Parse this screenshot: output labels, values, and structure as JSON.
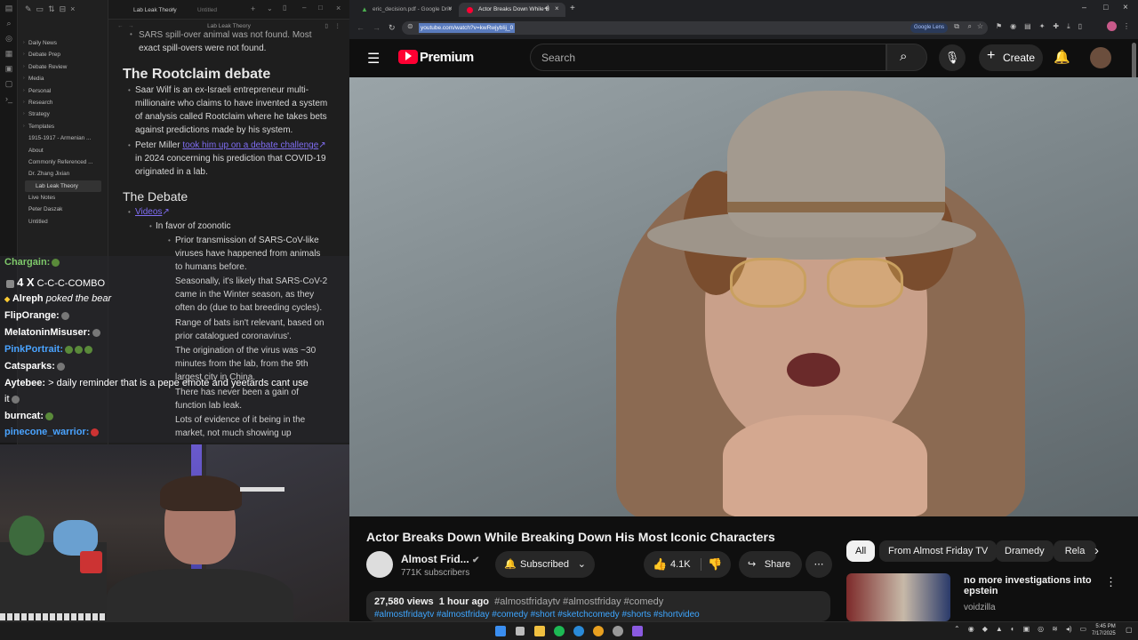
{
  "obsidian": {
    "tabs": [
      {
        "label": "Lab Leak Theory"
      },
      {
        "label": "Untitled"
      }
    ],
    "header": "Lab Leak Theory",
    "tree": [
      "Daily News",
      "Debate Prep",
      "Debate Review",
      "Media",
      "Personal",
      "Research",
      "Strategy",
      "Templates",
      "1915-1917 - Armenian ...",
      "About",
      "Commonly Referenced ...",
      "Dr. Zhang Jixian",
      "Lab Leak Theory",
      "Live Notes",
      "Peter Daszak",
      "Untitled"
    ],
    "content": {
      "top_line1": "SARS spill-over animal was not found. Most",
      "top_line2": "exact spill-overs were not found.",
      "h_rootclaim": "The Rootclaim debate",
      "p1": [
        "Saar Wilf is an ex-Israeli entrepreneur multi-",
        "millionaire who claims to have invented a system",
        "of analysis called Rootclaim where he takes bets",
        "against predictions made by his system."
      ],
      "p2_a": "Peter Miller",
      "p2_link": "took him up on a debate challenge",
      "p2_rest": [
        "in 2024 concerning his prediction that COVID-19",
        "originated in a lab."
      ],
      "h_debate": "The Debate",
      "videos_link": "Videos",
      "zoonotic": "In favor of zoonotic",
      "points": [
        [
          "Prior transmission of SARS-CoV-like",
          "viruses have happened from animals",
          "to humans before."
        ],
        [
          "Seasonally, it's likely that SARS-CoV-2",
          "came in the Winter season, as they",
          "often do (due to bat breeding cycles)."
        ],
        [
          "Range of bats isn't relevant, based on",
          "prior catalogued coronavirus'."
        ],
        [
          "The origination of the virus was ~30",
          "minutes from the lab, from the 9th",
          "largest city in China."
        ],
        [
          "There has never been a gain of",
          "function lab leak."
        ],
        [
          "Lots of evidence of it being in the",
          "market, not much showing up"
        ]
      ]
    }
  },
  "chat": [
    {
      "user": "Chargain:",
      "msg": "",
      "color": "#7ec86a"
    },
    {
      "user": "4 X",
      "msg": "C-C-C-COMBO",
      "color": "#ffffff"
    },
    {
      "user": "Alreph",
      "msg": "poked the bear",
      "color": "#ffffff"
    },
    {
      "user": "FlipOrange:",
      "msg": "",
      "color": "#ffffff"
    },
    {
      "user": "MelatoninMisuser:",
      "msg": "",
      "color": "#ffffff"
    },
    {
      "user": "PinkPortrait:",
      "msg": "",
      "color": "#4aa3ff"
    },
    {
      "user": "Catsparks:",
      "msg": "",
      "color": "#ffffff"
    },
    {
      "user": "Aytebee:",
      "msg": "> daily reminder that   is a pepe emote and yeetards cant use",
      "color": "#ffffff"
    },
    {
      "user": "",
      "msg": "it",
      "color": "#ffffff"
    },
    {
      "user": "burncat:",
      "msg": "",
      "color": "#ffffff"
    },
    {
      "user": "pinecone_warrior:",
      "msg": "",
      "color": "#4aa3ff"
    }
  ],
  "browser": {
    "tabs": [
      {
        "label": "eric_decision.pdf - Google Driv"
      },
      {
        "label": "Actor Breaks Down While B"
      }
    ],
    "url": "youtube.com/watch?v=kwRwjybIij_0",
    "lens": "Google Lens"
  },
  "youtube": {
    "logo": "Premium",
    "search_placeholder": "Search",
    "create": "Create",
    "title": "Actor Breaks Down While Breaking Down His Most Iconic Characters",
    "channel": "Almost Frid...",
    "subs": "771K subscribers",
    "subscribed": "Subscribed",
    "likes": "4.1K",
    "share": "Share",
    "views": "27,580 views",
    "age": "1 hour ago",
    "tags": "#almostfridaytv #almostfriday #comedy",
    "tags2": "#almostfridaytv #almostfriday #comedy #short #sketchcomedy #shorts #shortvideo",
    "chips": [
      "All",
      "From Almost Friday TV",
      "Dramedy",
      "Rela"
    ],
    "rec_title": [
      "no more investigations into",
      "epstein"
    ],
    "rec_channel": "voidzilla",
    "colors": {
      "red": "#ff0033",
      "accent": "#3ea6ff"
    }
  },
  "taskbar": {
    "time": "5:45 PM",
    "date": "7/17/2025"
  }
}
